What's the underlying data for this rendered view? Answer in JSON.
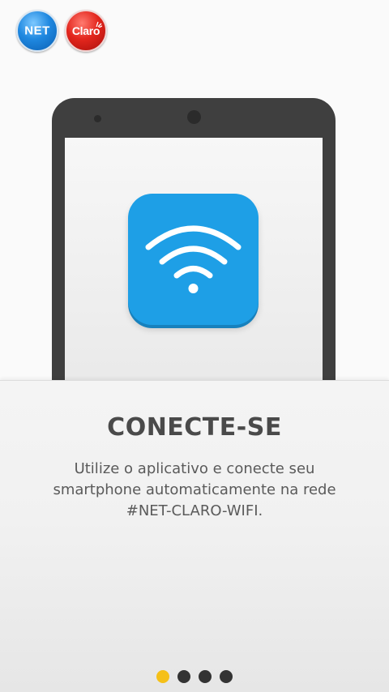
{
  "header": {
    "logo_net_text": "NET",
    "logo_claro_text": "Claro"
  },
  "illustration": {
    "icon": "wifi-icon",
    "tile_color": "#1e9fe6"
  },
  "content": {
    "title": "CONECTE-SE",
    "description": "Utilize o aplicativo e conecte seu smartphone automaticamente na rede #NET-CLARO-WIFI."
  },
  "pager": {
    "total_pages": 4,
    "current_page": 1,
    "active_color": "#f5c018",
    "inactive_color": "#333333"
  }
}
